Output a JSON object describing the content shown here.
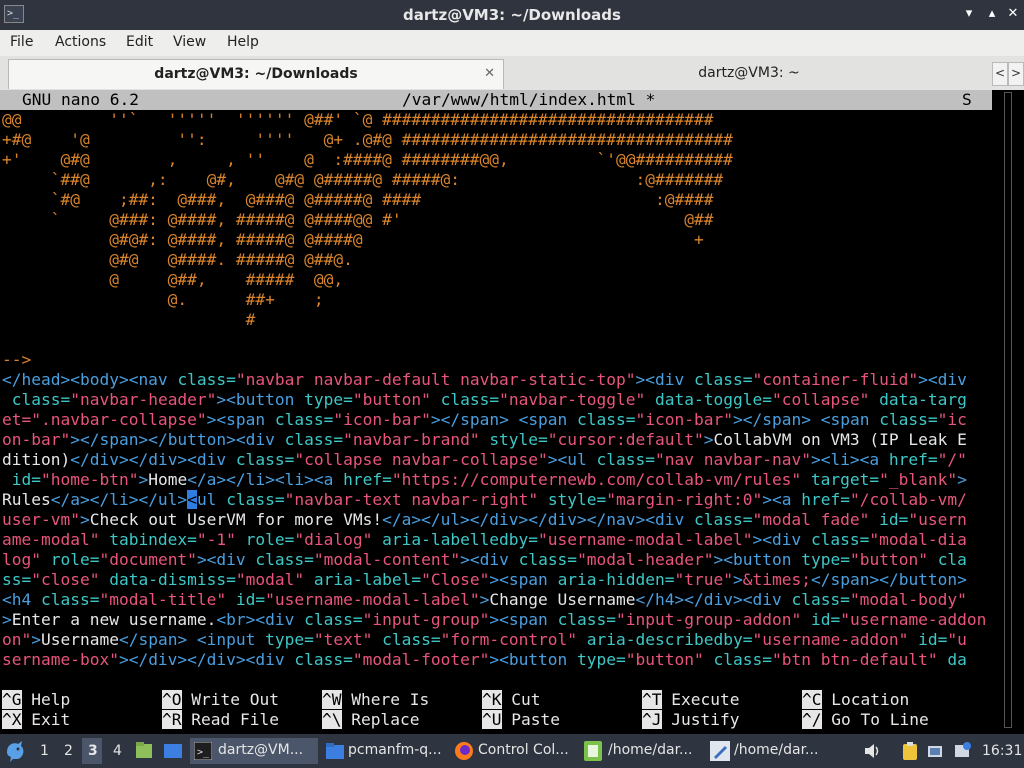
{
  "window": {
    "title": "dartz@VM3: ~/Downloads",
    "minimize": "▾",
    "maximize": "▴",
    "close": "✕"
  },
  "menu": [
    "File",
    "Actions",
    "Edit",
    "View",
    "Help"
  ],
  "tabs": [
    {
      "label": "dartz@VM3: ~/Downloads",
      "close": "✕"
    },
    {
      "label": "dartz@VM3: ~"
    }
  ],
  "tab_nav": {
    "prev": "<",
    "next": ">"
  },
  "nano": {
    "version": "GNU nano 6.2",
    "file": "/var/www/html/index.html *",
    "status": "S"
  },
  "art_lines": [
    "@@         ''`   '''''  '''''' @##' `@ ##################################",
    "+#@    '@         '':     ''''   @+ .@#@ ##################################",
    "+'    @#@        ,     , ''    @  :####@ ########@@,         `'@@##########",
    "     `##@      ,:    @#,    @#@ @#####@ #####@:                  :@#######",
    "     `#@    ;##:  @###,  @###@ @#####@ ####                        :@####",
    "     `     @###: @####, #####@ @####@@ #'                             @##",
    "           @#@#: @####, #####@ @####@                                  +",
    "           @#@   @####. #####@ @##@.",
    "           @     @##,    #####  @@,",
    "                 @.      ##+    ;",
    "                         #"
  ],
  "comment_end": "-->",
  "code_lines": [
    [
      [
        "tg",
        "</head><body><nav "
      ],
      [
        "at",
        "class="
      ],
      [
        "st",
        "\"navbar navbar-default navbar-static-top\""
      ],
      [
        "tg",
        "><div "
      ],
      [
        "at",
        "class="
      ],
      [
        "st",
        "\"container-fluid\""
      ],
      [
        "tg",
        "><div"
      ]
    ],
    [
      [
        "at",
        " class="
      ],
      [
        "st",
        "\"navbar-header\""
      ],
      [
        "tg",
        "><button "
      ],
      [
        "at",
        "type="
      ],
      [
        "st",
        "\"button\" "
      ],
      [
        "at",
        "class="
      ],
      [
        "st",
        "\"navbar-toggle\" "
      ],
      [
        "at",
        "data-toggle="
      ],
      [
        "st",
        "\"collapse\" "
      ],
      [
        "at",
        "data-targ"
      ]
    ],
    [
      [
        "st",
        "et=\".navbar-collapse\""
      ],
      [
        "tg",
        "><span "
      ],
      [
        "at",
        "class="
      ],
      [
        "st",
        "\"icon-bar\""
      ],
      [
        "tg",
        "></span> <span "
      ],
      [
        "at",
        "class="
      ],
      [
        "st",
        "\"icon-bar\""
      ],
      [
        "tg",
        "></span> <span "
      ],
      [
        "at",
        "class="
      ],
      [
        "st",
        "\"ic"
      ]
    ],
    [
      [
        "st",
        "on-bar\""
      ],
      [
        "tg",
        "></span></button><div "
      ],
      [
        "at",
        "class="
      ],
      [
        "st",
        "\"navbar-brand\" "
      ],
      [
        "at",
        "style="
      ],
      [
        "st",
        "\"cursor:default\""
      ],
      [
        "tg",
        ">"
      ],
      [
        "wh",
        "CollabVM on VM3 (IP Leak E"
      ]
    ],
    [
      [
        "wh",
        "dition)"
      ],
      [
        "tg",
        "</div></div><div "
      ],
      [
        "at",
        "class="
      ],
      [
        "st",
        "\"collapse navbar-collapse\""
      ],
      [
        "tg",
        "><ul "
      ],
      [
        "at",
        "class="
      ],
      [
        "st",
        "\"nav navbar-nav\""
      ],
      [
        "tg",
        "><li><a "
      ],
      [
        "at",
        "href="
      ],
      [
        "st",
        "\"/\""
      ]
    ],
    [
      [
        "at",
        " id="
      ],
      [
        "st",
        "\"home-btn\""
      ],
      [
        "tg",
        ">"
      ],
      [
        "wh",
        "Home"
      ],
      [
        "tg",
        "</a></li><li><a "
      ],
      [
        "at",
        "href="
      ],
      [
        "st",
        "\"https://computernewb.com/collab-vm/rules\" "
      ],
      [
        "at",
        "target="
      ],
      [
        "st",
        "\"_blank\""
      ],
      [
        "tg",
        ">"
      ]
    ],
    [
      [
        "wh",
        "Rules"
      ],
      [
        "tg",
        "</a></li></ul>"
      ],
      [
        "cur",
        "<"
      ],
      [
        "tg",
        "ul "
      ],
      [
        "at",
        "class="
      ],
      [
        "st",
        "\"navbar-text navbar-right\" "
      ],
      [
        "at",
        "style="
      ],
      [
        "st",
        "\"margin-right:0\""
      ],
      [
        "tg",
        "><a "
      ],
      [
        "at",
        "href="
      ],
      [
        "st",
        "\"/collab-vm/"
      ]
    ],
    [
      [
        "st",
        "user-vm\""
      ],
      [
        "tg",
        ">"
      ],
      [
        "wh",
        "Check out UserVM for more VMs!"
      ],
      [
        "tg",
        "</a></ul></div></div></nav><div "
      ],
      [
        "at",
        "class="
      ],
      [
        "st",
        "\"modal fade\" "
      ],
      [
        "at",
        "id="
      ],
      [
        "st",
        "\"usern"
      ]
    ],
    [
      [
        "st",
        "ame-modal\" "
      ],
      [
        "at",
        "tabindex="
      ],
      [
        "st",
        "\"-1\" "
      ],
      [
        "at",
        "role="
      ],
      [
        "st",
        "\"dialog\" "
      ],
      [
        "at",
        "aria-labelledby="
      ],
      [
        "st",
        "\"username-modal-label\""
      ],
      [
        "tg",
        "><div "
      ],
      [
        "at",
        "class="
      ],
      [
        "st",
        "\"modal-dia"
      ]
    ],
    [
      [
        "st",
        "log\" "
      ],
      [
        "at",
        "role="
      ],
      [
        "st",
        "\"document\""
      ],
      [
        "tg",
        "><div "
      ],
      [
        "at",
        "class="
      ],
      [
        "st",
        "\"modal-content\""
      ],
      [
        "tg",
        "><div "
      ],
      [
        "at",
        "class="
      ],
      [
        "st",
        "\"modal-header\""
      ],
      [
        "tg",
        "><button "
      ],
      [
        "at",
        "type="
      ],
      [
        "st",
        "\"button\" "
      ],
      [
        "at",
        "cla"
      ]
    ],
    [
      [
        "at",
        "ss="
      ],
      [
        "st",
        "\"close\" "
      ],
      [
        "at",
        "data-dismiss="
      ],
      [
        "st",
        "\"modal\" "
      ],
      [
        "at",
        "aria-label="
      ],
      [
        "st",
        "\"Close\""
      ],
      [
        "tg",
        "><span "
      ],
      [
        "at",
        "aria-hidden="
      ],
      [
        "st",
        "\"true\""
      ],
      [
        "tg",
        ">"
      ],
      [
        "st",
        "&times;"
      ],
      [
        "tg",
        "</span></button>"
      ]
    ],
    [
      [
        "tg",
        "<h4 "
      ],
      [
        "at",
        "class="
      ],
      [
        "st",
        "\"modal-title\" "
      ],
      [
        "at",
        "id="
      ],
      [
        "st",
        "\"username-modal-label\""
      ],
      [
        "tg",
        ">"
      ],
      [
        "wh",
        "Change Username"
      ],
      [
        "tg",
        "</h4></div><div "
      ],
      [
        "at",
        "class="
      ],
      [
        "st",
        "\"modal-body\""
      ]
    ],
    [
      [
        "tg",
        ">"
      ],
      [
        "wh",
        "Enter a new username."
      ],
      [
        "tg",
        "<br><div "
      ],
      [
        "at",
        "class="
      ],
      [
        "st",
        "\"input-group\""
      ],
      [
        "tg",
        "><span "
      ],
      [
        "at",
        "class="
      ],
      [
        "st",
        "\"input-group-addon\" "
      ],
      [
        "at",
        "id="
      ],
      [
        "st",
        "\"username-addon"
      ]
    ],
    [
      [
        "st",
        "on\""
      ],
      [
        "tg",
        ">"
      ],
      [
        "wh",
        "Username"
      ],
      [
        "tg",
        "</span> <input "
      ],
      [
        "at",
        "type="
      ],
      [
        "st",
        "\"text\" "
      ],
      [
        "at",
        "class="
      ],
      [
        "st",
        "\"form-control\" "
      ],
      [
        "at",
        "aria-describedby="
      ],
      [
        "st",
        "\"username-addon\" "
      ],
      [
        "at",
        "id="
      ],
      [
        "st",
        "\"u"
      ]
    ],
    [
      [
        "st",
        "sername-box\""
      ],
      [
        "tg",
        "></div></div><div "
      ],
      [
        "at",
        "class="
      ],
      [
        "st",
        "\"modal-footer\""
      ],
      [
        "tg",
        "><button "
      ],
      [
        "at",
        "type="
      ],
      [
        "st",
        "\"button\" "
      ],
      [
        "at",
        "class="
      ],
      [
        "st",
        "\"btn btn-default\" "
      ],
      [
        "at",
        "da"
      ]
    ]
  ],
  "shortcuts": [
    {
      "key": "^G",
      "label": "Help"
    },
    {
      "key": "^O",
      "label": "Write Out"
    },
    {
      "key": "^W",
      "label": "Where Is"
    },
    {
      "key": "^K",
      "label": "Cut"
    },
    {
      "key": "^T",
      "label": "Execute"
    },
    {
      "key": "^C",
      "label": "Location"
    },
    {
      "key": "^X",
      "label": "Exit"
    },
    {
      "key": "^R",
      "label": "Read File"
    },
    {
      "key": "^\\",
      "label": "Replace"
    },
    {
      "key": "^U",
      "label": "Paste"
    },
    {
      "key": "^J",
      "label": "Justify"
    },
    {
      "key": "^/",
      "label": "Go To Line"
    }
  ],
  "taskbar": {
    "workspaces": [
      "1",
      "2",
      "3",
      "4"
    ],
    "active_workspace": "3",
    "apps": [
      {
        "label": "dartz@VM..."
      },
      {
        "label": "pcmanfm-q..."
      },
      {
        "label": "Control Col..."
      },
      {
        "label": "/home/dar..."
      },
      {
        "label": "/home/dar..."
      }
    ],
    "clock": "16:31"
  },
  "colors": {
    "nano_bar": "#c0c0c0",
    "tag": "#4a9fe0",
    "attr": "#3ec7c7",
    "string": "#e8557a",
    "art": "#d8842c",
    "taskbar": "#2e3440",
    "titlebar": "#2f343f"
  }
}
